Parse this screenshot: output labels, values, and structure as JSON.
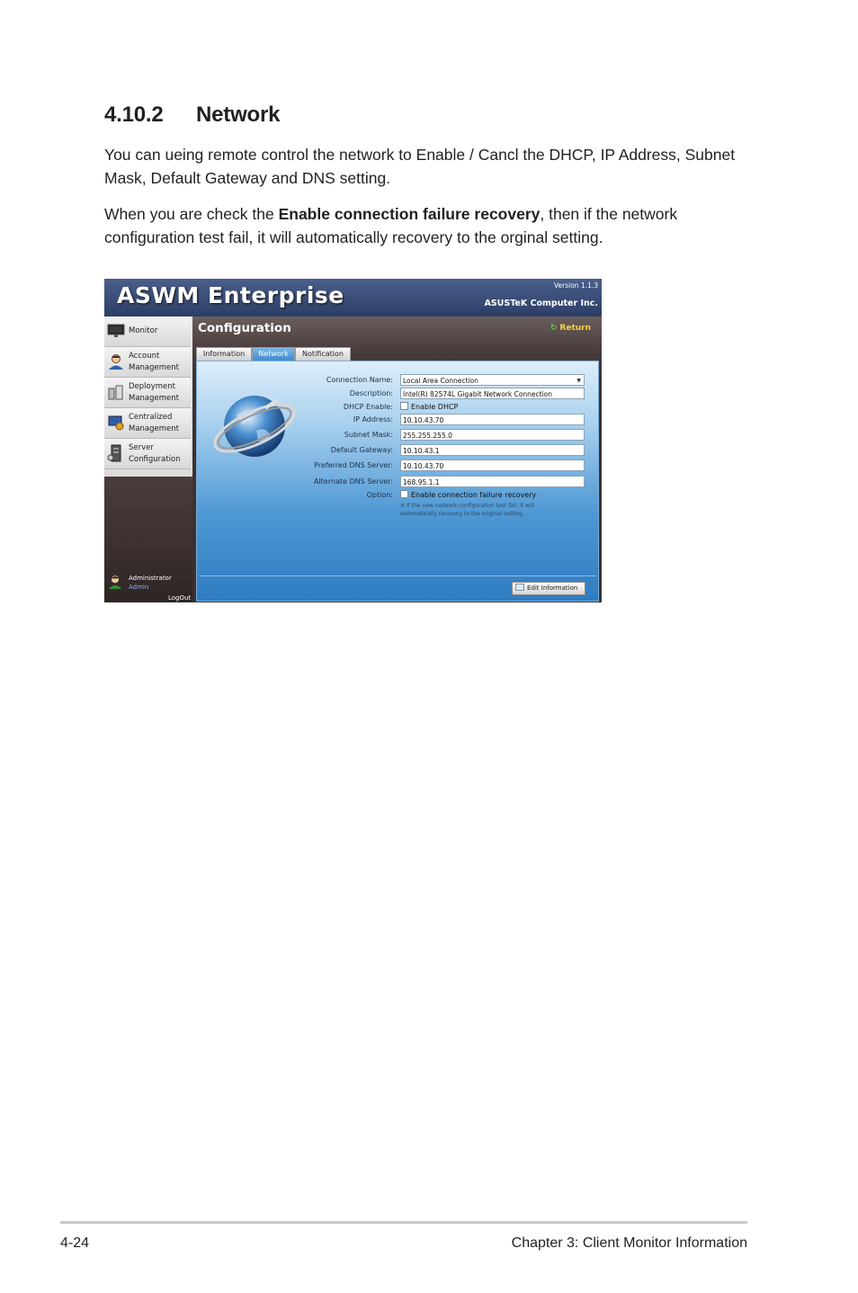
{
  "section": {
    "number": "4.10.2",
    "title": "Network"
  },
  "paragraph1": "You can ueing remote control the network to Enable / Cancl the DHCP, IP Address, Subnet Mask, Default Gateway and DNS setting.",
  "paragraph2": {
    "before": "When you are check the ",
    "bold": "Enable connection failure recovery",
    "after": ", then if the network configuration test fail, it will automatically recovery to the orginal setting."
  },
  "screenshot": {
    "app_title": "ASWM Enterprise",
    "version": "Version 1.1.3",
    "company": "ASUSTeK Computer Inc.",
    "sidebar": [
      {
        "label": "Monitor",
        "icon": "monitor-icon"
      },
      {
        "label": "Account\nManagement",
        "icon": "user-icon"
      },
      {
        "label": "Deployment\nManagement",
        "icon": "deploy-icon"
      },
      {
        "label": "Centralized\nManagement",
        "icon": "central-icon"
      },
      {
        "label": "Server\nConfiguration",
        "icon": "server-icon"
      }
    ],
    "admin": {
      "role": "Administrator",
      "name": "Admin",
      "logout": "LogOut"
    },
    "page_title": "Configuration",
    "return_label": "Return",
    "tabs": [
      "Information",
      "Network",
      "Notification"
    ],
    "active_tab": "Network",
    "form": {
      "connection_name": {
        "label": "Connection Name:",
        "value": "Local Area Connection"
      },
      "description": {
        "label": "Description:",
        "value": "Intel(R) 82574L Gigabit Network Connection"
      },
      "dhcp": {
        "label": "DHCP Enable:",
        "value": "Enable DHCP"
      },
      "ip": {
        "label": "IP Address:",
        "value": "10.10.43.70"
      },
      "subnet": {
        "label": "Subnet Mask:",
        "value": "255.255.255.0"
      },
      "gateway": {
        "label": "Default Gateway:",
        "value": "10.10.43.1"
      },
      "dns1": {
        "label": "Preferred DNS Server:",
        "value": "10.10.43.70"
      },
      "dns2": {
        "label": "Alternate DNS Server:",
        "value": "168.95.1.1"
      },
      "option": {
        "label": "Option:",
        "value": "Enable connection failure recovery"
      },
      "hint": "※ If the new network configuration test fail, it will automatically recovery to the original setting."
    },
    "edit_button": "Edit Information"
  },
  "footer": {
    "page": "4-24",
    "chapter": "Chapter 3: Client Monitor Information"
  }
}
